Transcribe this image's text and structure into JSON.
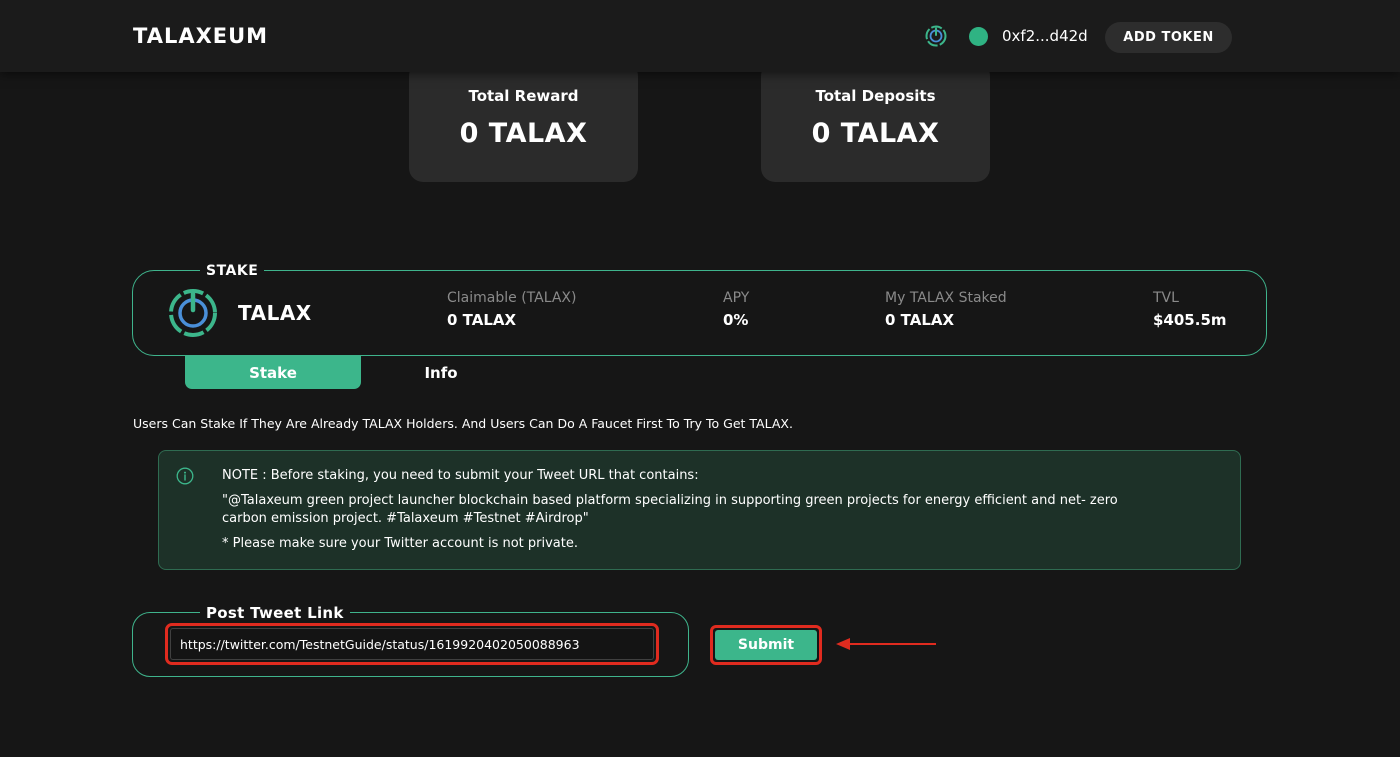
{
  "header": {
    "logo": "TALAXEUM",
    "wallet_address": "0xf2...d42d",
    "add_token_label": "ADD TOKEN"
  },
  "cards": {
    "total_reward": {
      "label": "Total Reward",
      "value": "0 TALAX"
    },
    "total_deposits": {
      "label": "Total Deposits",
      "value": "0 TALAX"
    }
  },
  "stake": {
    "legend": "STAKE",
    "token_name": "TALAX",
    "stats": [
      {
        "label": "Claimable (TALAX)",
        "value": "0 TALAX"
      },
      {
        "label": "APY",
        "value": "0%"
      },
      {
        "label": "My TALAX Staked",
        "value": "0 TALAX"
      },
      {
        "label": "TVL",
        "value": "$405.5m"
      }
    ]
  },
  "tabs": {
    "stake_label": "Stake",
    "info_label": "Info"
  },
  "description": "Users Can Stake If They Are Already TALAX Holders. And Users Can Do A Faucet First To Try To Get TALAX.",
  "note": {
    "line1": "NOTE : Before staking, you need to submit your Tweet URL that contains:",
    "line2": "\"@Talaxeum green project launcher blockchain based platform specializing in supporting green projects for energy efficient and net- zero",
    "line3": "carbon emission project. #Talaxeum #Testnet #Airdrop\"",
    "line4": "* Please make sure your Twitter account is not private."
  },
  "tweet": {
    "legend": "Post Tweet Link",
    "input_value": "https://twitter.com/TestnetGuide/status/1619920402050088963",
    "submit_label": "Submit"
  },
  "colors": {
    "accent": "#3cb68b",
    "highlight": "#e02b1f",
    "background": "#161616"
  },
  "icons": {
    "header": "talax-power-icon",
    "wallet": "wallet-status-dot",
    "token": "talax-power-icon",
    "note": "info-icon",
    "annotation": "arrow-left-icon"
  }
}
